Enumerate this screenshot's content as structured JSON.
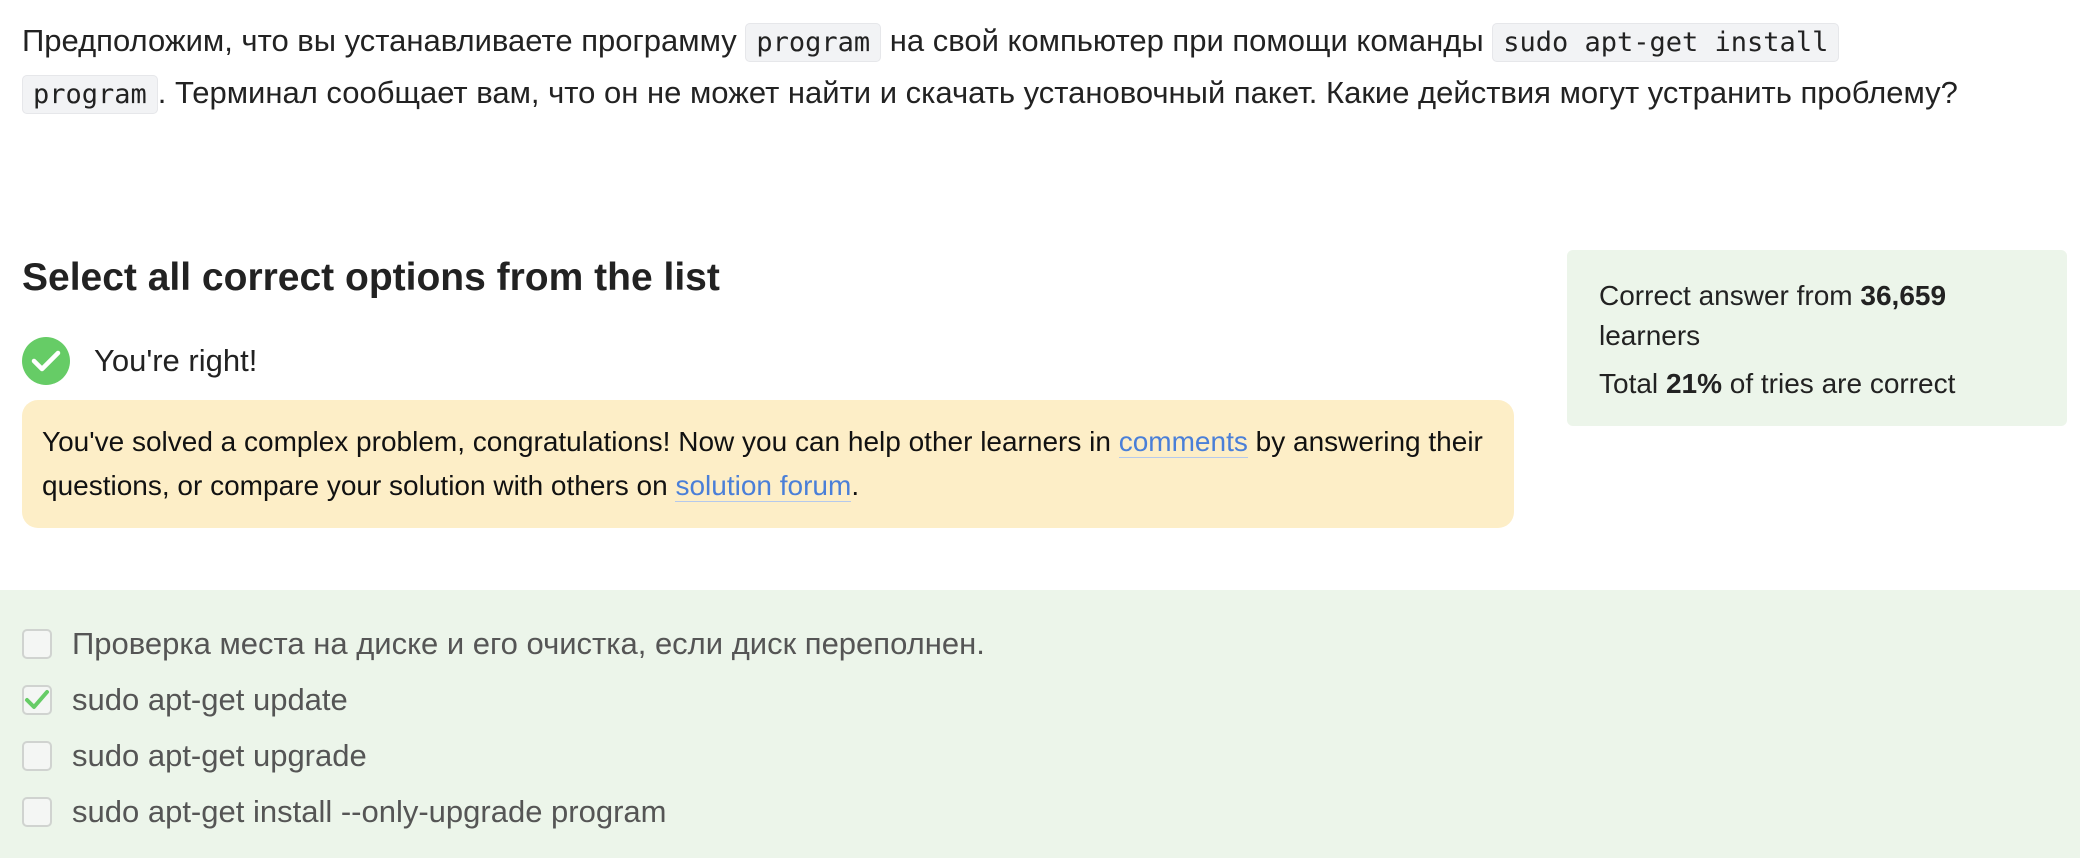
{
  "question": {
    "part1": "Предположим, что вы устанавливаете программу ",
    "code1": "program",
    "part2": " на свой компьютер при помощи команды ",
    "code2a": "sudo apt-get install",
    "code2b": "program",
    "part3": ". Терминал сообщает вам, что он не может найти и скачать установочный пакет. Какие действия могут устранить проблему?"
  },
  "section_title": "Select all correct options from the list",
  "result": {
    "text": "You're right!"
  },
  "congrats": {
    "before_link1": "You've solved a complex problem, congratulations! Now you can help other learners in ",
    "link1": "comments",
    "between_links": " by answering their questions, or compare your solution with others on ",
    "link2": "solution forum",
    "after_link2": "."
  },
  "stats": {
    "line1_prefix": "Correct answer from ",
    "learners_count": "36,659",
    "line1_suffix": " learners",
    "line2_prefix": "Total ",
    "correct_percent": "21%",
    "line2_suffix": " of tries are correct"
  },
  "options": [
    {
      "label": "Проверка места на диске и его очистка, если диск переполнен.",
      "checked": false
    },
    {
      "label": "sudo apt-get update",
      "checked": true
    },
    {
      "label": "sudo apt-get upgrade",
      "checked": false
    },
    {
      "label": "sudo apt-get install --only-upgrade program",
      "checked": false
    }
  ],
  "colors": {
    "success_green": "#66cc66",
    "feedback_bg": "#fdeec7",
    "options_bg": "#ecf5ea",
    "link": "#4a7fd8"
  }
}
